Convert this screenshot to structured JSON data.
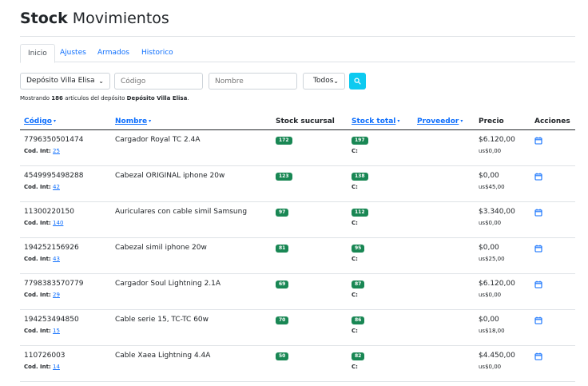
{
  "page": {
    "title_bold": "Stock",
    "title_rest": "Movimientos"
  },
  "tabs": [
    {
      "label": "Inicio",
      "active": true
    },
    {
      "label": "Ajustes",
      "active": false
    },
    {
      "label": "Armados",
      "active": false
    },
    {
      "label": "Historico",
      "active": false
    }
  ],
  "filters": {
    "deposit": "Depósito Villa Elisa",
    "code_placeholder": "Código",
    "name_placeholder": "Nombre",
    "status": "Todos",
    "search_icon": "search-icon"
  },
  "summary": {
    "prefix": "Mostrando",
    "count": "186",
    "middle": "articulos del depósito",
    "deposit": "Depósito Villa Elisa",
    "suffix": "."
  },
  "columns": {
    "code": "Código",
    "name": "Nombre",
    "stock_branch": "Stock sucursal",
    "stock_total": "Stock total",
    "supplier": "Proveedor",
    "price": "Precio",
    "actions": "Acciones",
    "sort_arrow": "▾"
  },
  "labels": {
    "cod_int": "Cod. Int:",
    "c": "C:"
  },
  "colors": {
    "accent": "#0d6efd",
    "badge": "#198754",
    "search_button": "#0dcaf0"
  },
  "rows": [
    {
      "code": "7796350501474",
      "cod_int": "25",
      "name": "Cargador Royal TC 2.4A",
      "stock_branch": "172",
      "stock_total": "197",
      "price": "$6.120,00",
      "usd": "us$0,00"
    },
    {
      "code": "4549995498288",
      "cod_int": "42",
      "name": "Cabezal ORIGINAL iphone 20w",
      "stock_branch": "123",
      "stock_total": "138",
      "price": "$0,00",
      "usd": "us$45,00"
    },
    {
      "code": "11300220150",
      "cod_int": "140",
      "name": "Auriculares con cable simil Samsung",
      "stock_branch": "97",
      "stock_total": "112",
      "price": "$3.340,00",
      "usd": "us$0,00"
    },
    {
      "code": "194252156926",
      "cod_int": "43",
      "name": "Cabezal simil iphone 20w",
      "stock_branch": "81",
      "stock_total": "95",
      "price": "$0,00",
      "usd": "us$25,00"
    },
    {
      "code": "7798383570779",
      "cod_int": "29",
      "name": "Cargador Soul Lightning 2.1A",
      "stock_branch": "69",
      "stock_total": "87",
      "price": "$6.120,00",
      "usd": "us$0,00"
    },
    {
      "code": "194253494850",
      "cod_int": "15",
      "name": "Cable serie 15, TC-TC 60w",
      "stock_branch": "70",
      "stock_total": "86",
      "price": "$0,00",
      "usd": "us$18,00"
    },
    {
      "code": "110726003",
      "cod_int": "14",
      "name": "Cable Xaea Lightning 4.4A",
      "stock_branch": "50",
      "stock_total": "82",
      "price": "$4.450,00",
      "usd": "us$0,00"
    }
  ]
}
